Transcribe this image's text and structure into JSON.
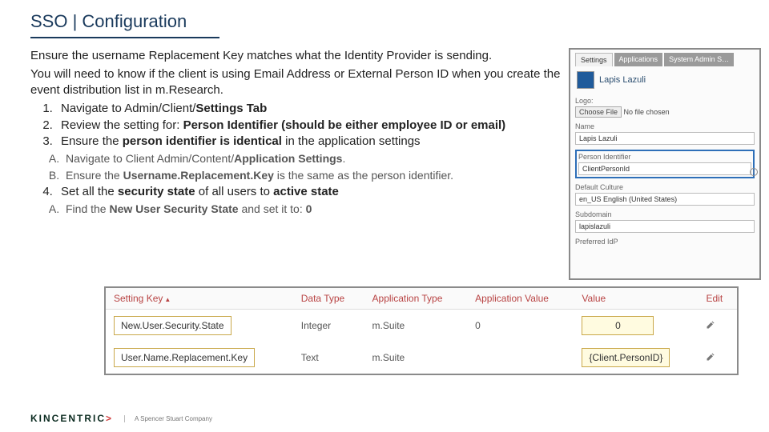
{
  "title": "SSO | Configuration",
  "instructions": {
    "para1": "Ensure the username Replacement Key matches what the Identity Provider is sending.",
    "para2": "You will need to know if the client is using Email Address or External Person ID when you create the event distribution list in m.Research.",
    "steps": [
      {
        "pre": "Navigate to Admin/Client/",
        "bold": "Settings Tab"
      },
      {
        "pre": "Review the setting for: ",
        "bold": "Person Identifier (should be either employee ID or email)"
      },
      {
        "pre": "Ensure the ",
        "bold": "person identifier is identical",
        "post": " in the application settings"
      },
      {
        "pre": "Set all the ",
        "bold": "security state",
        "mid": " of all users to ",
        "bold2": "active state"
      }
    ],
    "sub3": [
      {
        "pre": "Navigate to Client Admin/Content/",
        "bold": "Application Settings",
        "post": "."
      },
      {
        "pre": "Ensure the ",
        "bold": "Username.Replacement.Key",
        "post": " is the same as the person identifier."
      }
    ],
    "sub4": [
      {
        "pre": "Find the ",
        "bold": "New User Security State",
        "post": " and set it to: ",
        "bold2": "0"
      }
    ]
  },
  "panel": {
    "tabs": [
      "Settings",
      "Applications",
      "System Admin S…"
    ],
    "brand": "Lapis Lazuli",
    "logo_label": "Logo:",
    "choose_file": "Choose File",
    "no_file": "No file chosen",
    "name_label": "Name",
    "name_value": "Lapis Lazuli",
    "pid_label": "Person Identifier",
    "pid_value": "ClientPersonId",
    "culture_label": "Default Culture",
    "culture_value": "en_US English (United States)",
    "subdomain_label": "Subdomain",
    "subdomain_value": "lapislazuli",
    "idp_label": "Preferred IdP"
  },
  "table": {
    "headers": [
      "Setting Key",
      "Data Type",
      "Application Type",
      "Application Value",
      "Value",
      "Edit"
    ],
    "rows": [
      {
        "key": "New.User.Security.State",
        "dtype": "Integer",
        "atype": "m.Suite",
        "avalue": "0",
        "value": "0"
      },
      {
        "key": "User.Name.Replacement.Key",
        "dtype": "Text",
        "atype": "m.Suite",
        "avalue": "",
        "value": "{Client.PersonID}"
      }
    ]
  },
  "footer": {
    "brand": "KINCENTRIC",
    "tagline": "A Spencer Stuart Company"
  }
}
